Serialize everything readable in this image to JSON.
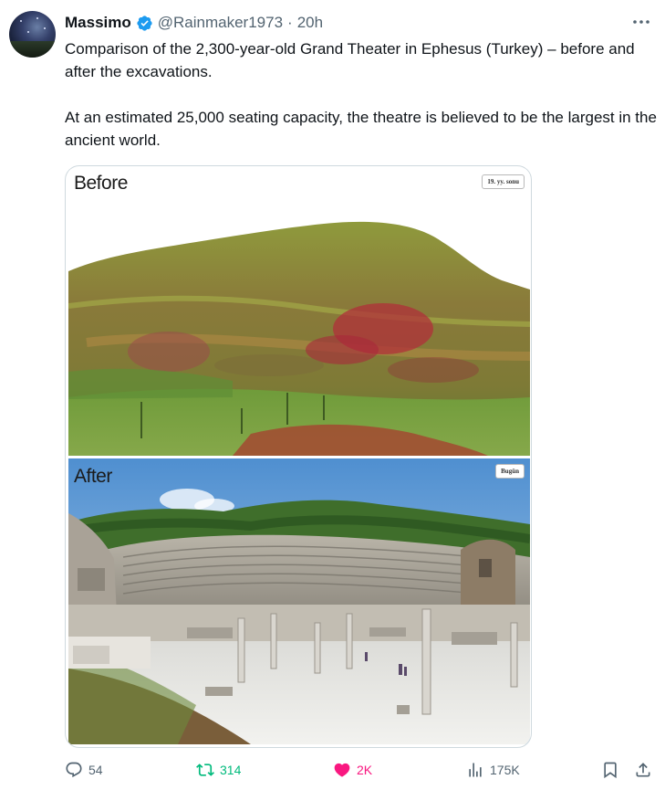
{
  "author": {
    "name": "Massimo",
    "handle": "@Rainmaker1973",
    "separator": "·",
    "time": "20h"
  },
  "tweet": {
    "paragraph_1": "Comparison of the 2,300-year-old Grand Theater in Ephesus (Turkey) – before and after the excavations.",
    "paragraph_2": "At an estimated 25,000 seating capacity, the theatre is believed to be the largest in the ancient world."
  },
  "media": {
    "before_label": "Before",
    "before_tag": "19. yy. sonu",
    "after_label": "After",
    "after_tag": "Bugün"
  },
  "actions": {
    "replies": "54",
    "retweets": "314",
    "likes": "2K",
    "views": "175K"
  },
  "colors": {
    "verified": "#1d9bf0",
    "retweet_active": "#00ba7c",
    "like_active": "#f91880",
    "secondary_text": "#536471"
  },
  "icons": [
    "verified-badge-icon",
    "more-icon",
    "reply-icon",
    "retweet-icon",
    "like-icon",
    "views-icon",
    "bookmark-icon",
    "share-icon"
  ]
}
